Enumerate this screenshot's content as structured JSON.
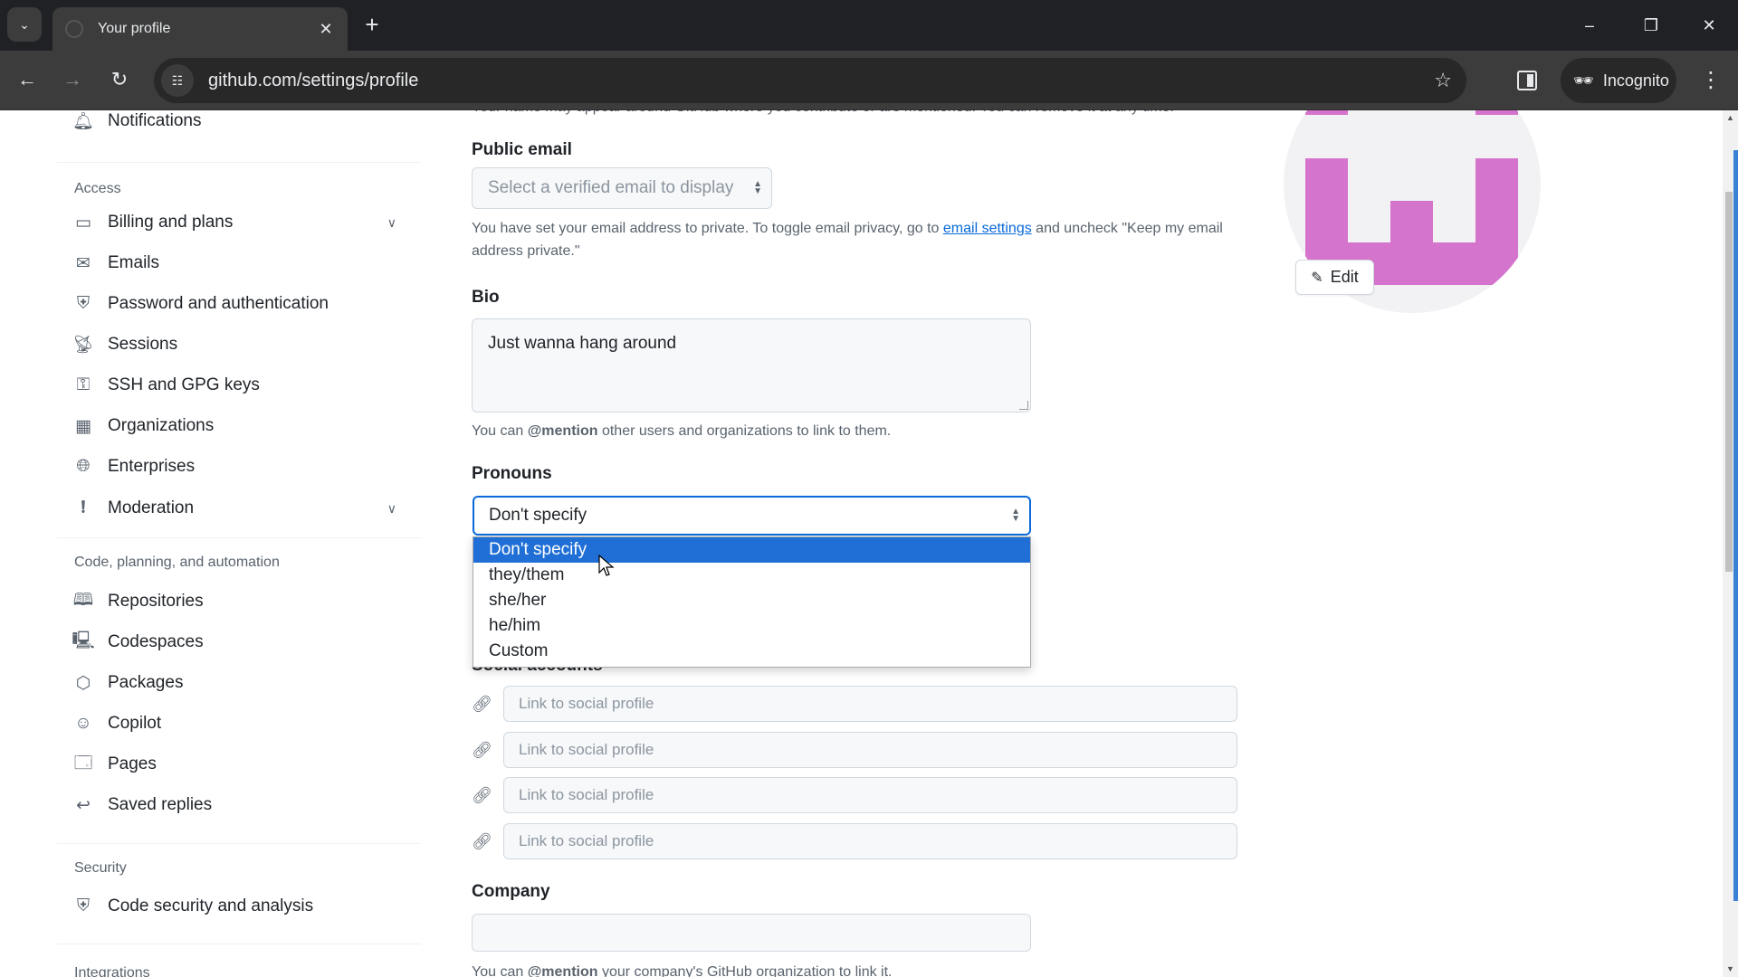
{
  "browser": {
    "tab_title": "Your profile",
    "url": "github.com/settings/profile",
    "incognito_label": "Incognito",
    "icons": {
      "tab_search": "chevron-down-icon",
      "tab_close": "close-icon",
      "new_tab": "plus-icon",
      "minimize": "minimize-icon",
      "restore": "restore-icon",
      "close_window": "close-icon",
      "back": "arrow-left-icon",
      "forward": "arrow-right-icon",
      "reload": "reload-icon",
      "site_info": "tune-icon",
      "bookmark": "star-icon",
      "side_panel": "side-panel-icon",
      "incognito": "incognito-icon",
      "menu": "kebab-menu-icon"
    }
  },
  "sidebar": {
    "top_item": {
      "label": "Notifications",
      "icon": "bell-icon"
    },
    "sections": [
      {
        "heading": "Access",
        "items": [
          {
            "label": "Billing and plans",
            "icon": "credit-card-icon",
            "expandable": true
          },
          {
            "label": "Emails",
            "icon": "mail-icon"
          },
          {
            "label": "Password and authentication",
            "icon": "shield-lock-icon"
          },
          {
            "label": "Sessions",
            "icon": "broadcast-icon"
          },
          {
            "label": "SSH and GPG keys",
            "icon": "key-icon"
          },
          {
            "label": "Organizations",
            "icon": "organization-icon"
          },
          {
            "label": "Enterprises",
            "icon": "globe-icon"
          },
          {
            "label": "Moderation",
            "icon": "report-icon",
            "expandable": true
          }
        ]
      },
      {
        "heading": "Code, planning, and automation",
        "items": [
          {
            "label": "Repositories",
            "icon": "repo-icon"
          },
          {
            "label": "Codespaces",
            "icon": "codespaces-icon"
          },
          {
            "label": "Packages",
            "icon": "package-icon"
          },
          {
            "label": "Copilot",
            "icon": "copilot-icon"
          },
          {
            "label": "Pages",
            "icon": "browser-icon"
          },
          {
            "label": "Saved replies",
            "icon": "reply-icon"
          }
        ]
      },
      {
        "heading": "Security",
        "items": [
          {
            "label": "Code security and analysis",
            "icon": "shield-lock-icon"
          }
        ]
      }
    ],
    "partial_next_heading": "Integrations"
  },
  "form": {
    "name_hint_partial": "Your name may appear around GitHub where you contribute or are mentioned. You can remove it at any time.",
    "public_email": {
      "label": "Public email",
      "placeholder": "Select a verified email to display",
      "hint_before": "You have set your email address to private. To toggle email privacy, go to ",
      "hint_link": "email settings",
      "hint_after": " and uncheck \"Keep my email address private.\""
    },
    "bio": {
      "label": "Bio",
      "value": "Just wanna hang around",
      "hint_before": "You can ",
      "hint_bold": "@mention",
      "hint_after": " other users and organizations to link to them."
    },
    "pronouns": {
      "label": "Pronouns",
      "value": "Don't specify",
      "options": [
        "Don't specify",
        "they/them",
        "she/her",
        "he/him",
        "Custom"
      ],
      "highlighted_index": 0
    },
    "social_accounts": {
      "label": "Social accounts",
      "placeholder": "Link to social profile",
      "count": 4
    },
    "company": {
      "label": "Company",
      "value": "",
      "hint_before": "You can ",
      "hint_bold": "@mention",
      "hint_after": " your company's GitHub organization to link it."
    }
  },
  "avatar": {
    "edit_label": "Edit",
    "color": "#d474cc"
  }
}
